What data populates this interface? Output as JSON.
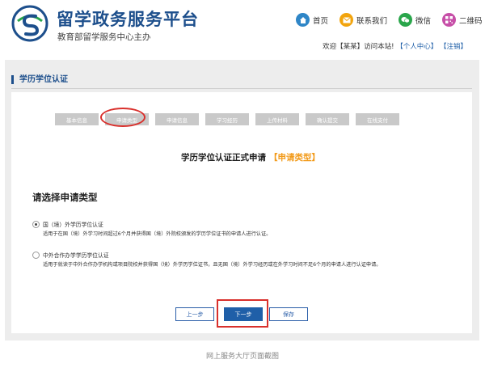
{
  "header": {
    "title": "留学政务服务平台",
    "subtitle": "教育部留学服务中心主办",
    "links": [
      {
        "label": "首页",
        "icon": "home-icon"
      },
      {
        "label": "联系我们",
        "icon": "mail-icon"
      },
      {
        "label": "微信",
        "icon": "wechat-icon"
      },
      {
        "label": "二维码",
        "icon": "qrcode-icon"
      }
    ],
    "userbar": {
      "welcome_prefix": "欢迎【",
      "user_name": "某某",
      "welcome_suffix": "】访问本站!",
      "personal_center": "【个人中心】",
      "logout": "【注销】"
    }
  },
  "section": {
    "title": "学历学位认证"
  },
  "steps": [
    "基本信息",
    "申请类型",
    "申请信息",
    "学习经历",
    "上传材料",
    "确认提交",
    "在线支付"
  ],
  "form": {
    "heading": "学历学位认证正式申请",
    "heading_sub": "【申请类型】",
    "choose_title": "请选择申请类型",
    "options": [
      {
        "title": "国（境）外学历学位认证",
        "desc": "适用于在国（境）外学习时间超过6个月并获得国（境）外院校颁发的学历学位证书的申请人进行认证。",
        "checked": true
      },
      {
        "title": "中外合作办学学历学位认证",
        "desc": "适用于就读于中外合作办学机构或项目院校并获得国（境）外学历学位证书，且无国（境）外学习经历或在外学习时间不足6个月的申请人进行认证申请。",
        "checked": false
      }
    ]
  },
  "buttons": {
    "prev": "上一步",
    "next": "下一步",
    "save": "保存"
  },
  "caption": "网上服务大厅页面截图",
  "colors": {
    "brand": "#1d4f8c",
    "accent": "#f29b1b",
    "highlight": "#d9302c"
  }
}
